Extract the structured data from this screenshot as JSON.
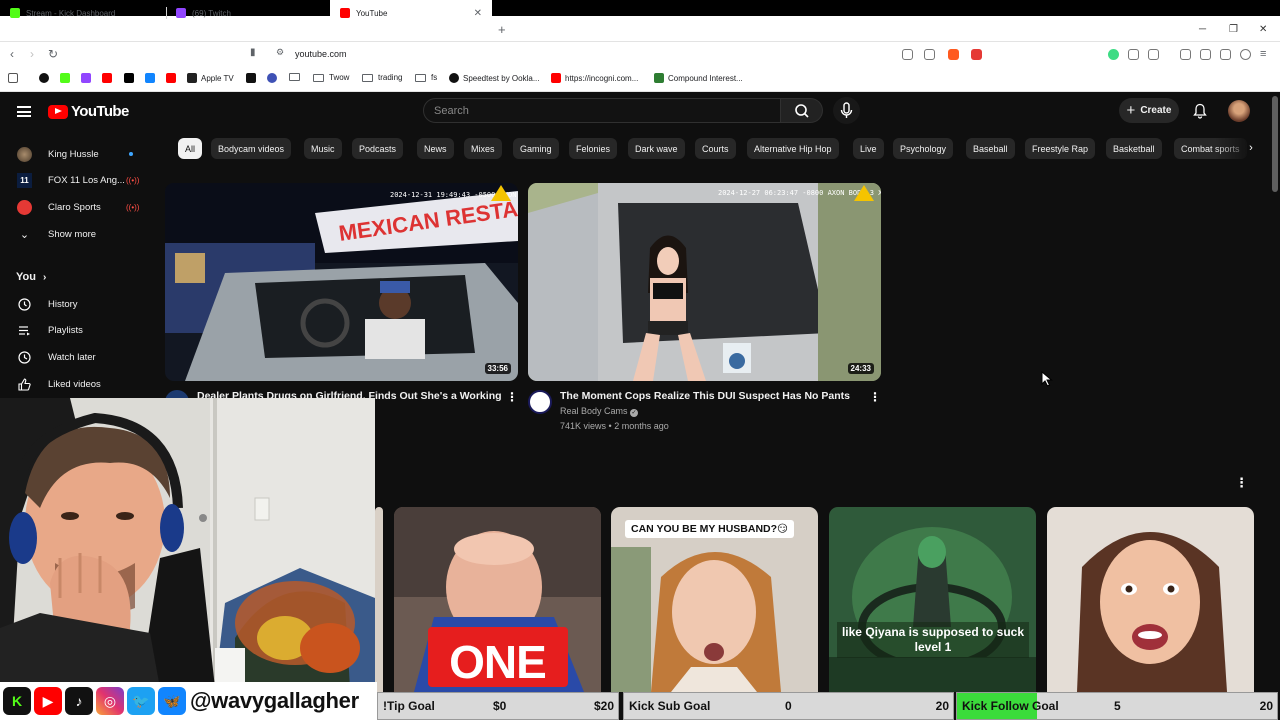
{
  "browser": {
    "tabs": [
      {
        "title": "Stream - Kick Dashboard",
        "color": "#53fc18"
      },
      {
        "title": "(69) Twitch",
        "color": "#9146ff"
      },
      {
        "title": "YouTube",
        "color": "#ff0000"
      }
    ],
    "url": "youtube.com",
    "bookmarks": {
      "apple_tv": "Apple TV",
      "twow": "Twow",
      "trading": "trading",
      "fs": "fs",
      "speedtest": "Speedtest by Ookla...",
      "incogni": "https://incogni.com...",
      "compound": "Compound Interest..."
    }
  },
  "youtube": {
    "logo": "YouTube",
    "search_placeholder": "Search",
    "create_label": "Create",
    "sidebar": {
      "subscriptions": [
        {
          "label": "King Hussle",
          "indicator": "dot"
        },
        {
          "label": "FOX 11 Los Ang...",
          "indicator": "live"
        },
        {
          "label": "Claro Sports",
          "indicator": "live"
        }
      ],
      "show_more": "Show more",
      "you_heading": "You",
      "you_items": [
        "History",
        "Playlists",
        "Watch later",
        "Liked videos"
      ]
    },
    "chips": [
      "All",
      "Bodycam videos",
      "Music",
      "Podcasts",
      "News",
      "Mixes",
      "Gaming",
      "Felonies",
      "Dark wave",
      "Courts",
      "Alternative Hip Hop",
      "Live",
      "Psychology",
      "Baseball",
      "Freestyle Rap",
      "Basketball",
      "Combat sports"
    ],
    "videos": [
      {
        "title": "Dealer Plants Drugs on Girlfriend, Finds Out She's a Working",
        "duration": "33:56",
        "overlay": "2024-12-31 19:49:43 -0500 AXON BODY 3 X60A9542E",
        "sign": "MEXICAN RESTAUR"
      },
      {
        "title": "The Moment Cops Realize This DUI Suspect Has No Pants",
        "duration": "24:33",
        "channel": "Real Body Cams",
        "views": "741K views",
        "age": "2 months ago",
        "overlay": "2024-12-27 06:23:47 -0800 AXON BODY 3 X81A52F2D"
      }
    ],
    "shorts": [
      {
        "caption": "ONE"
      },
      {
        "caption": "CAN YOU BE MY HUSBAND?😏"
      },
      {
        "caption": "like Qiyana is supposed to suck level 1"
      },
      {
        "caption": ""
      }
    ]
  },
  "stream_overlay": {
    "handle": "@wavygallagher",
    "goals": [
      {
        "label": "!Tip Goal",
        "current": "$0",
        "target": "$20"
      },
      {
        "label": "Kick Sub Goal",
        "current": "0",
        "target": "20"
      },
      {
        "label": "Kick Follow Goal",
        "current": "5",
        "target": "20",
        "progress": 0.25
      }
    ]
  }
}
